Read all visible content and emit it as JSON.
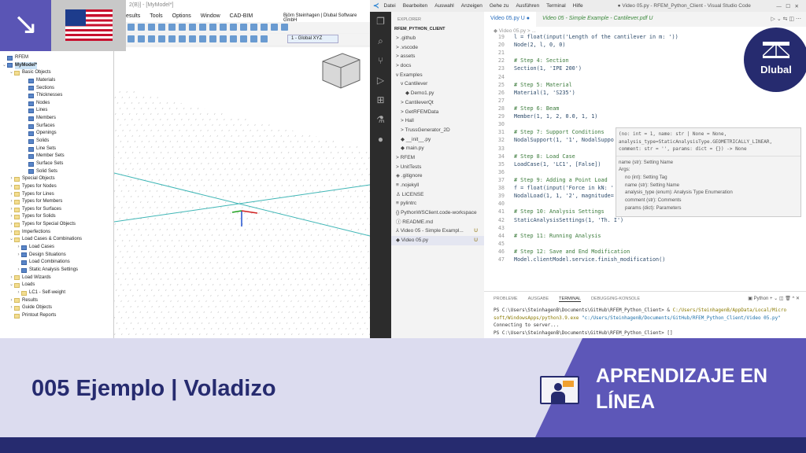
{
  "rfem": {
    "title": "2(B)] - [MyModel*]",
    "menu": [
      "esults",
      "Tools",
      "Options",
      "Window",
      "CAD-BIM"
    ],
    "user": "Björn Steinhagen | Dlubal Software GmbH",
    "view_select": "1 - Global XYZ",
    "tree": [
      {
        "label": "RFEM",
        "lvl": 0,
        "arrow": "",
        "icon": "o"
      },
      {
        "label": "MyModel*",
        "lvl": 0,
        "arrow": "v",
        "icon": "o",
        "sel": true
      },
      {
        "label": "Basic Objects",
        "lvl": 1,
        "arrow": "v",
        "icon": "f"
      },
      {
        "label": "Materials",
        "lvl": 3,
        "arrow": "",
        "icon": "o"
      },
      {
        "label": "Sections",
        "lvl": 3,
        "arrow": "",
        "icon": "o"
      },
      {
        "label": "Thicknesses",
        "lvl": 3,
        "arrow": "",
        "icon": "o"
      },
      {
        "label": "Nodes",
        "lvl": 3,
        "arrow": "",
        "icon": "o"
      },
      {
        "label": "Lines",
        "lvl": 3,
        "arrow": "",
        "icon": "o"
      },
      {
        "label": "Members",
        "lvl": 3,
        "arrow": "",
        "icon": "o"
      },
      {
        "label": "Surfaces",
        "lvl": 3,
        "arrow": "",
        "icon": "o"
      },
      {
        "label": "Openings",
        "lvl": 3,
        "arrow": "",
        "icon": "o"
      },
      {
        "label": "Solids",
        "lvl": 3,
        "arrow": "",
        "icon": "o"
      },
      {
        "label": "Line Sets",
        "lvl": 3,
        "arrow": "",
        "icon": "o"
      },
      {
        "label": "Member Sets",
        "lvl": 3,
        "arrow": "",
        "icon": "o"
      },
      {
        "label": "Surface Sets",
        "lvl": 3,
        "arrow": "",
        "icon": "o"
      },
      {
        "label": "Solid Sets",
        "lvl": 3,
        "arrow": "",
        "icon": "o"
      },
      {
        "label": "Special Objects",
        "lvl": 1,
        "arrow": ">",
        "icon": "f"
      },
      {
        "label": "Types for Nodes",
        "lvl": 1,
        "arrow": ">",
        "icon": "f"
      },
      {
        "label": "Types for Lines",
        "lvl": 1,
        "arrow": ">",
        "icon": "f"
      },
      {
        "label": "Types for Members",
        "lvl": 1,
        "arrow": ">",
        "icon": "f"
      },
      {
        "label": "Types for Surfaces",
        "lvl": 1,
        "arrow": ">",
        "icon": "f"
      },
      {
        "label": "Types for Solids",
        "lvl": 1,
        "arrow": ">",
        "icon": "f"
      },
      {
        "label": "Types for Special Objects",
        "lvl": 1,
        "arrow": ">",
        "icon": "f"
      },
      {
        "label": "Imperfections",
        "lvl": 1,
        "arrow": ">",
        "icon": "f"
      },
      {
        "label": "Load Cases & Combinations",
        "lvl": 1,
        "arrow": "v",
        "icon": "f"
      },
      {
        "label": "Load Cases",
        "lvl": 2,
        "arrow": ">",
        "icon": "o"
      },
      {
        "label": "Design Situations",
        "lvl": 2,
        "arrow": ">",
        "icon": "o"
      },
      {
        "label": "Load Combinations",
        "lvl": 2,
        "arrow": "",
        "icon": "o"
      },
      {
        "label": "Static Analysis Settings",
        "lvl": 2,
        "arrow": ">",
        "icon": "o"
      },
      {
        "label": "Load Wizards",
        "lvl": 1,
        "arrow": ">",
        "icon": "f"
      },
      {
        "label": "Loads",
        "lvl": 1,
        "arrow": "v",
        "icon": "f"
      },
      {
        "label": "LC1 - Self-weight",
        "lvl": 2,
        "arrow": ">",
        "icon": "f"
      },
      {
        "label": "Results",
        "lvl": 1,
        "arrow": ">",
        "icon": "f"
      },
      {
        "label": "Guide Objects",
        "lvl": 1,
        "arrow": ">",
        "icon": "f"
      },
      {
        "label": "Printout Reports",
        "lvl": 1,
        "arrow": "",
        "icon": "f"
      }
    ]
  },
  "vscode": {
    "menu": [
      "Datei",
      "Bearbeiten",
      "Auswahl",
      "Anzeigen",
      "Gehe zu",
      "Ausführen",
      "Terminal",
      "Hilfe"
    ],
    "window_title": "● Video 05.py - RFEM_Python_Client - Visual Studio Code",
    "explorer_label": "EXPLORER",
    "project": "RFEM_PYTHON_CLIENT",
    "files": [
      {
        "label": "> .github",
        "lvl": 1
      },
      {
        "label": "> .vscode",
        "lvl": 1
      },
      {
        "label": "> assets",
        "lvl": 1
      },
      {
        "label": "> docs",
        "lvl": 1
      },
      {
        "label": "v Examples",
        "lvl": 1
      },
      {
        "label": "v Cantilever",
        "lvl": 2
      },
      {
        "label": "◆ Demo1.py",
        "lvl": 3
      },
      {
        "label": "> CantileverQt",
        "lvl": 2
      },
      {
        "label": "> GetRFEMData",
        "lvl": 2
      },
      {
        "label": "> Hall",
        "lvl": 2
      },
      {
        "label": "> TrussGenerator_2D",
        "lvl": 2
      },
      {
        "label": "◆ __init__.py",
        "lvl": 2
      },
      {
        "label": "◆ main.py",
        "lvl": 2
      },
      {
        "label": "> RFEM",
        "lvl": 1
      },
      {
        "label": "> UnitTests",
        "lvl": 1
      },
      {
        "label": "◈ .gitignore",
        "lvl": 1
      },
      {
        "label": "≡ .nojekyll",
        "lvl": 1
      },
      {
        "label": "♙ LICENSE",
        "lvl": 1
      },
      {
        "label": "≡ pylintrc",
        "lvl": 1
      },
      {
        "label": "{} PythonWSClient.code-workspace",
        "lvl": 1
      },
      {
        "label": "ⓘ README.md",
        "lvl": 1
      },
      {
        "label": "⅄ Video 05 - Simple Exampl...",
        "lvl": 1,
        "badge": "U"
      },
      {
        "label": "◆ Video 05.py",
        "lvl": 1,
        "badge": "U",
        "sel": true
      }
    ],
    "tabs": [
      "Video 05.py U ●",
      "Video 05 - Simple Example - Cantilever.pdf U"
    ],
    "breadcrumb": "◆ Video 05.py > ...",
    "code": [
      [
        "19",
        "l = float(input('Length of the cantilever in m: '))"
      ],
      [
        "20",
        "Node(2, l, 0, 0)"
      ],
      [
        "21",
        ""
      ],
      [
        "22",
        "# Step 4: Section"
      ],
      [
        "23",
        "Section(1, 'IPE 200')"
      ],
      [
        "24",
        ""
      ],
      [
        "25",
        "# Step 5: Material"
      ],
      [
        "26",
        "Material(1, 'S235')"
      ],
      [
        "27",
        ""
      ],
      [
        "28",
        "# Step 6: Beam"
      ],
      [
        "29",
        "Member(1, 1, 2, 0.0, 1, 1)"
      ],
      [
        "30",
        ""
      ],
      [
        "31",
        "# Step 7: Support Conditions"
      ],
      [
        "32",
        "NodalSupport(1, '1', NodalSuppo"
      ],
      [
        "33",
        ""
      ],
      [
        "34",
        "# Step 8: Load Case"
      ],
      [
        "35",
        "LoadCase(1, 'LC1', [False])"
      ],
      [
        "36",
        ""
      ],
      [
        "37",
        "# Step 9: Adding a Point Load"
      ],
      [
        "38",
        "f = float(input('Force in kN: '"
      ],
      [
        "39",
        "NodalLoad(1, 1, '2', magnitude="
      ],
      [
        "40",
        ""
      ],
      [
        "41",
        "# Step 10: Analysis Settings"
      ],
      [
        "42",
        "StaticAnalysisSettings(1, 'Th. I')"
      ],
      [
        "43",
        ""
      ],
      [
        "44",
        "# Step 11: Running Analysis"
      ],
      [
        "45",
        ""
      ],
      [
        "46",
        "# Step 12: Save and End Modification"
      ],
      [
        "47",
        "Model.clientModel.service.finish_modification()"
      ]
    ],
    "tooltip": {
      "sig1": "(no: int = 1, name: str | None = None,",
      "sig2": "analysis_type=StaticAnalysisType.GEOMETRICALLY_LINEAR,",
      "sig3": "comment: str = '', params: dict = {}) -> None",
      "doc": "name (str): Setting Name",
      "args_label": "Args:",
      "args": [
        "no (int): Setting Tag",
        "name (str): Setting Name",
        "analysis_type (enum): Analysis Type Enumeration",
        "comment (str): Comments",
        "params (dict): Parameters"
      ]
    },
    "panel_tabs": [
      "PROBLEME",
      "AUSGABE",
      "TERMINAL",
      "DEBUGGING-KONSOLE"
    ],
    "shell": "Python",
    "terminal": {
      "prompt": "PS C:\\Users\\SteinhagenB\\Documents\\GitHub\\RFEM_Python_Client> & ",
      "exe1": "C:/Users/SteinhagenB/AppData/Local/Micro",
      "exe2": "soft/WindowsApps/python3.9.exe ",
      "arg": "\"c:/Users/SteinhagenB/Documents/GitHub/RFEM_Python_Client/Video 05.py\"",
      "line3": "Connecting to server...",
      "line4": "PS C:\\Users\\SteinhagenB\\Documents\\GitHub\\RFEM_Python_Client> []"
    }
  },
  "logo": "Dlubal",
  "banner": {
    "title": "005 Ejemplo | Voladizo",
    "learn1": "APRENDIZAJE EN",
    "learn2": "LÍNEA"
  },
  "colors": {
    "purple": "#5d57b8",
    "navy": "#262b6f",
    "banner_bg": "#dcdcef"
  }
}
